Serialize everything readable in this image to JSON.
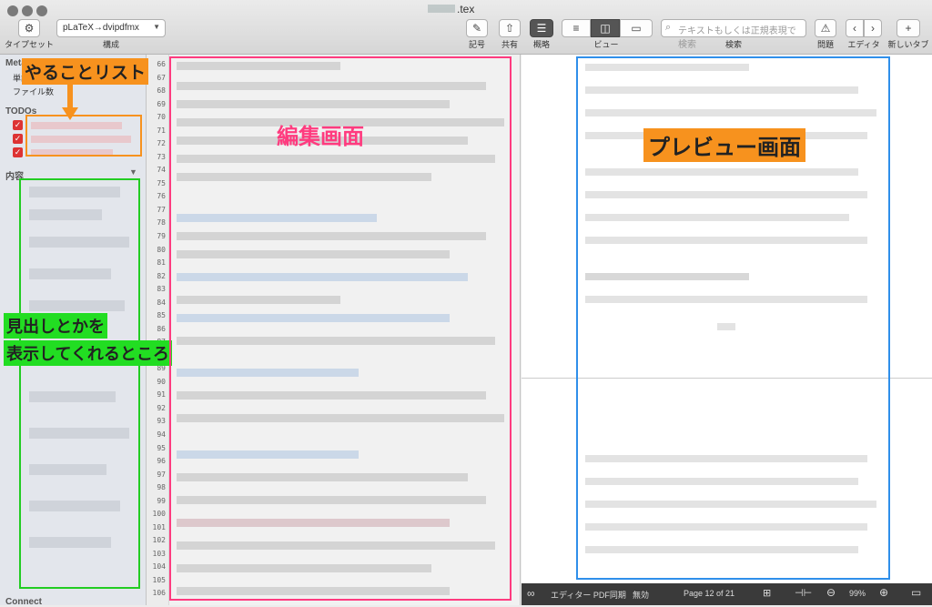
{
  "window": {
    "title": ".tex",
    "traffic_lights": [
      "close",
      "minimize",
      "zoom"
    ]
  },
  "toolbar": {
    "typeset_label": "タイプセット",
    "config_label": "構成",
    "config_value": "pLaTeX→dvipdfmx",
    "symbols_label": "記号",
    "share_label": "共有",
    "outline_label": "概略",
    "view_label": "ビュー",
    "search_placeholder": "テキストもしくは正規表現で検索",
    "search_label": "検索",
    "issues_label": "問題",
    "editor_label": "エディタ",
    "newtab_label": "新しいタブ"
  },
  "sidebar": {
    "meta_heading": "Meta",
    "meta_items": [
      "単語数",
      "ファイル数"
    ],
    "todos_heading": "TODOs",
    "contents_heading": "内容",
    "connect_label": "Connect"
  },
  "editor": {
    "line_numbers": [
      "66",
      "67",
      "68",
      "69",
      "70",
      "71",
      "72",
      "73",
      "74",
      "75",
      "76",
      "77",
      "78",
      "79",
      "80",
      "81",
      "82",
      "83",
      "84",
      "85",
      "86",
      "87",
      "88",
      "89",
      "90",
      "91",
      "92",
      "93",
      "94",
      "95",
      "96",
      "97",
      "98",
      "99",
      "100",
      "101",
      "102",
      "103",
      "104",
      "105",
      "106"
    ]
  },
  "statusbar": {
    "sync_label": "エディター PDF同期",
    "sync_value": "無効",
    "page_text": "Page 12 of 21",
    "zoom": "99%"
  },
  "annotations": {
    "todo": "やることリスト",
    "outline_line1": "見出しとかを",
    "outline_line2": "表示してくれるところ",
    "editor": "編集画面",
    "preview": "プレビュー画面"
  },
  "colors": {
    "todo": "#f7921e",
    "outline": "#22cc22",
    "editor": "#ff3b7f",
    "preview": "#2f8fea"
  }
}
